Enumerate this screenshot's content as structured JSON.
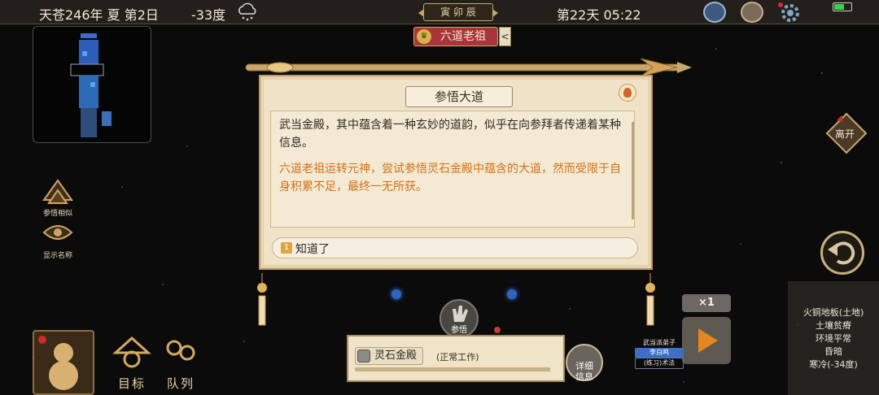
{
  "top_bar": {
    "date": "天苍246年 夏 第2日",
    "temperature": "-33度",
    "weather_icon": "cloud-snow-icon",
    "period": "寅 卯 辰",
    "day_time": "第22天 05:22"
  },
  "character": {
    "name": "六道老祖",
    "collapse_glyph": "<"
  },
  "dialog": {
    "title": "参悟大道",
    "paragraph_1": "武当金殿，其中蕴含着一种玄妙的道韵，似乎在向参拜者传递着某种信息。",
    "paragraph_2": "六道老祖运转元神，尝试参悟灵石金殿中蕴含的大道，然而受限于自身积累不足，最终一无所获。",
    "option_number": "1",
    "option_label": "知道了"
  },
  "left_buttons": [
    {
      "label": "参悟相似"
    },
    {
      "label": "显示名称"
    }
  ],
  "right": {
    "leave_label": "离开"
  },
  "info_panel": [
    "火铜地板(土地)",
    "土壤贫瘠",
    "环境平常",
    "昏暗",
    "寒冷(-34度)"
  ],
  "speed": {
    "label": "×1"
  },
  "bottom": {
    "location_name": "灵石金殿",
    "location_status": "(正常工作)",
    "detail_label_1": "详细",
    "detail_label_2": "信息",
    "action_label": "参悟",
    "disciple_sect": "武当派弟子",
    "disciple_name": "李白鸣",
    "disciple_task": "(练习)术法"
  },
  "bottom_left": {
    "target_label": "目标",
    "queue_label": "队列"
  },
  "colors": {
    "accent_orange": "#d2701a",
    "scroll_paper": "#efe2c6",
    "char_tag_red": "#a8343c"
  }
}
